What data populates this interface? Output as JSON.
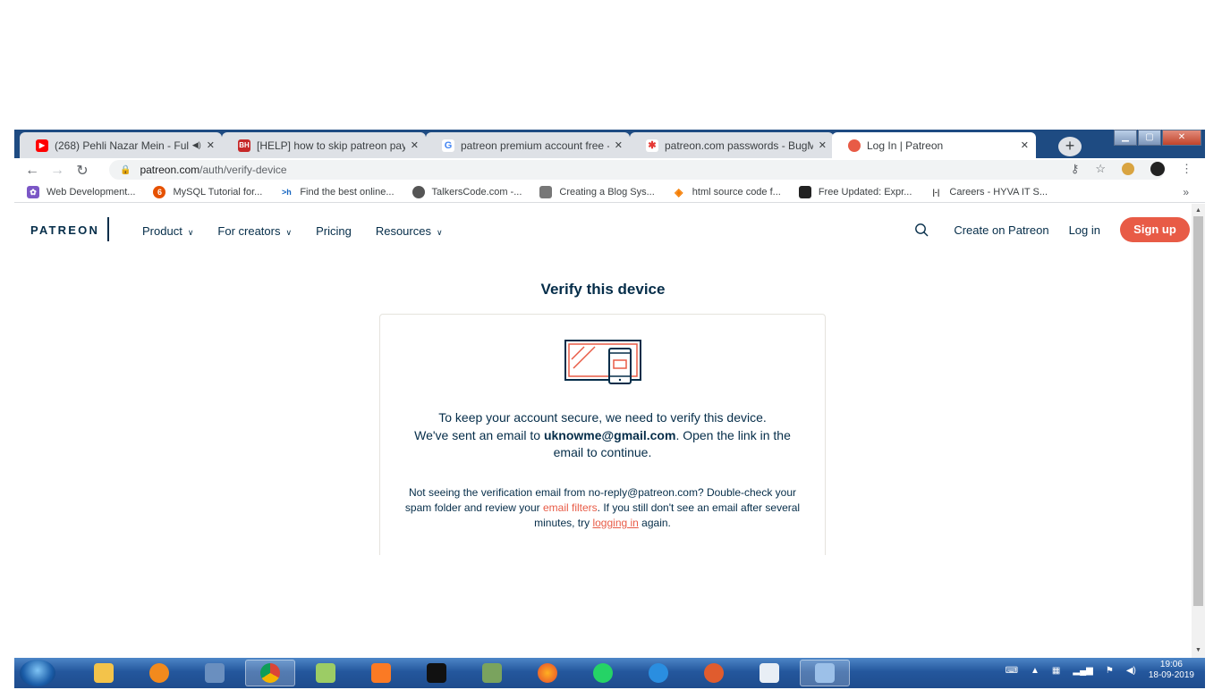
{
  "browser": {
    "tabs": [
      {
        "title": "(268) Pehli Nazar Mein - Full",
        "favicon": "youtube-icon",
        "color": "#ff0000",
        "audio": true
      },
      {
        "title": "[HELP] how to skip patreon pay",
        "favicon": "bh-icon",
        "color": "#c62828"
      },
      {
        "title": "patreon premium account free -",
        "favicon": "google-icon",
        "color": "#4285f4"
      },
      {
        "title": "patreon.com passwords - BugM",
        "favicon": "bug-icon",
        "color": "#e53935"
      },
      {
        "title": "Log In | Patreon",
        "favicon": "patreon-icon",
        "color": "#e85b46"
      }
    ],
    "new_tab": "+",
    "url_host": "patreon.com",
    "url_path": "/auth/verify-device",
    "bookmarks": [
      {
        "label": "Web Development...",
        "color": "#7b57c6"
      },
      {
        "label": "MySQL Tutorial for...",
        "color": "#e65100"
      },
      {
        "label": "Find the best online...",
        "color": "#1565c0",
        "glyph": ">h"
      },
      {
        "label": "TalkersCode.com -...",
        "color": "#555555"
      },
      {
        "label": "Creating a Blog Sys...",
        "color": "#777777"
      },
      {
        "label": "html source code f...",
        "color": "#f57c00"
      },
      {
        "label": "Free Updated: Expr...",
        "color": "#222222"
      },
      {
        "label": "Careers - HYVA IT S...",
        "color": "#444444",
        "glyph": "|-|"
      }
    ]
  },
  "patreon": {
    "logo": "PATREON",
    "menu": [
      {
        "label": "Product",
        "chevron": true
      },
      {
        "label": "For creators",
        "chevron": true
      },
      {
        "label": "Pricing",
        "chevron": false
      },
      {
        "label": "Resources",
        "chevron": true
      }
    ],
    "create_link": "Create on Patreon",
    "login_link": "Log in",
    "signup": "Sign up",
    "brand_color": "#e85b46",
    "navy": "#052d49"
  },
  "verify": {
    "title": "Verify this device",
    "line1": "To keep your account secure, we need to verify this device.",
    "line2_pre": "We've sent an email to ",
    "email": "uknowme@gmail.com",
    "line2_post": ". Open the link in the email to continue.",
    "sub_pre": "Not seeing the verification email from no-reply@patreon.com? Double-check your spam folder and review your ",
    "email_filters": "email filters",
    "sub_mid": ". If you still don't see an email after several minutes, try ",
    "logging_in": "logging in",
    "sub_post": " again."
  },
  "taskbar": {
    "time": "19:06",
    "date": "18-09-2019"
  }
}
